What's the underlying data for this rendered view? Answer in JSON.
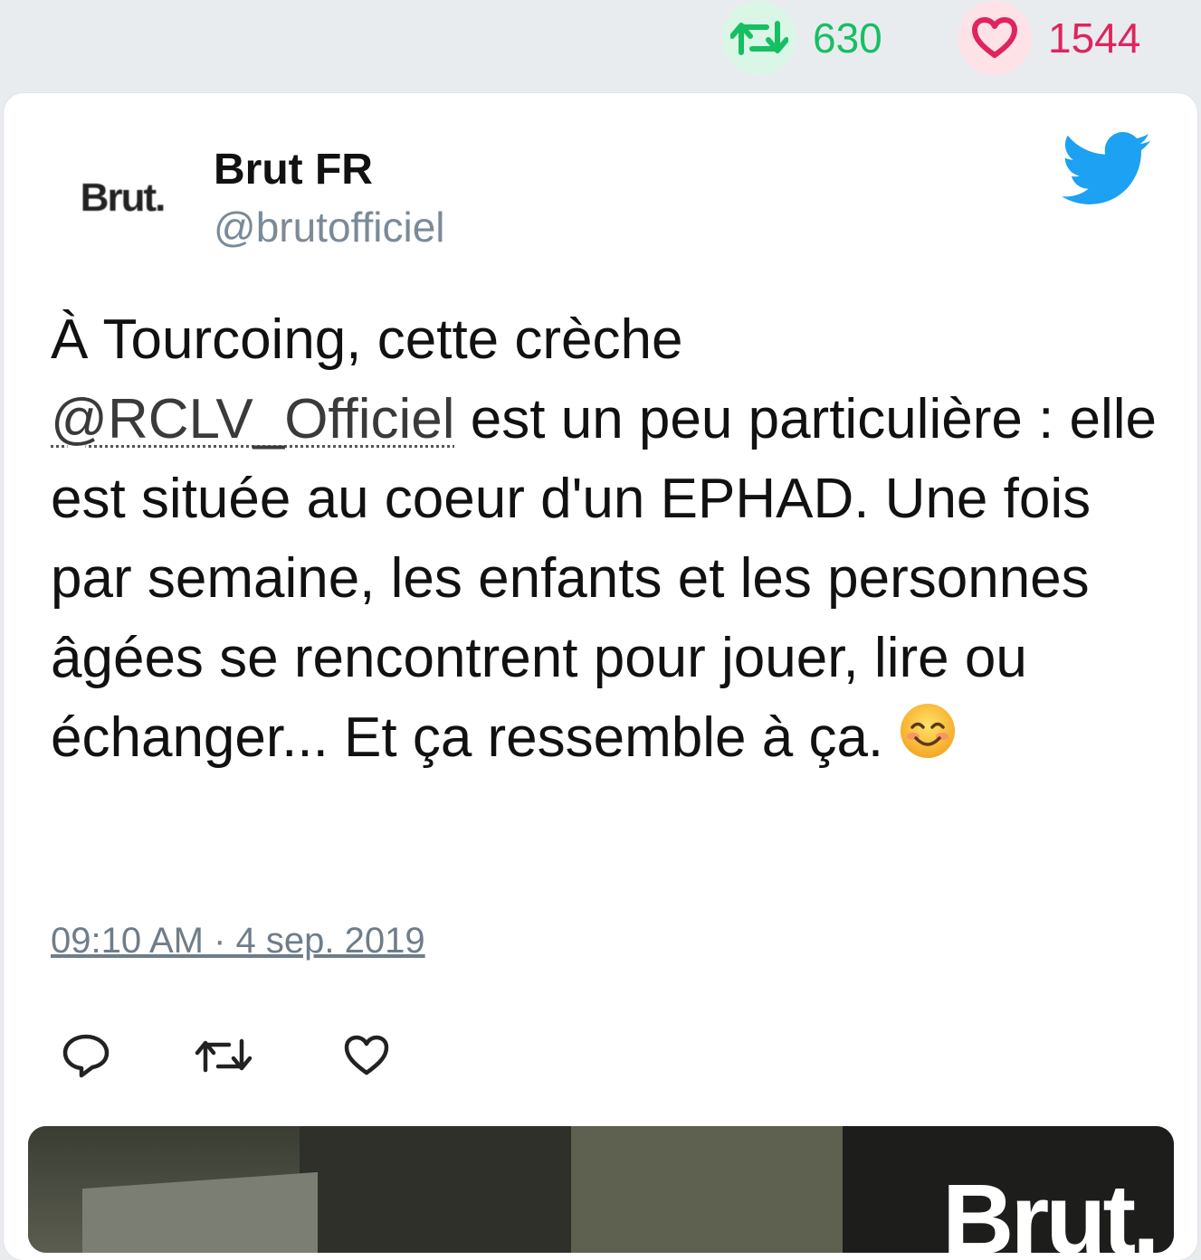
{
  "stats": {
    "retweets": "630",
    "likes": "1544"
  },
  "author": {
    "name": "Brut FR",
    "handle": "@brutofficiel",
    "avatar_text": "Brut."
  },
  "tweet": {
    "line1": "À Tourcoing, cette crèche",
    "mention": "@RCLV_Officiel",
    "after_mention": " est un peu particulière : elle est située au coeur d'un EPHAD. Une fois par semaine, les enfants et les personnes âgées se rencontrent pour jouer, lire ou échanger... Et ça ressemble à ça. ",
    "emoji": "smiling-face-icon"
  },
  "timestamp": "09:10 AM · 4 sep. 2019",
  "media": {
    "logo_text": "Brut."
  },
  "colors": {
    "retweet": "#17bf63",
    "like": "#e0245e",
    "twitter": "#1da1f2"
  }
}
